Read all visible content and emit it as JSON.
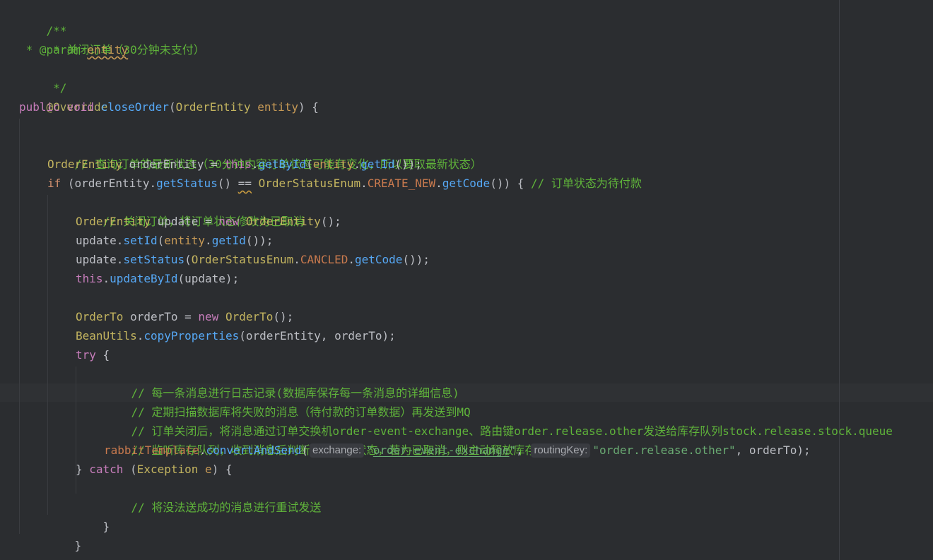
{
  "editor": {
    "doc_open": "/**",
    "doc_line1": " * 关闭订单（30分钟未支付）",
    "doc_star": " * ",
    "doc_param_tag": "@param",
    "doc_param_name": "entity",
    "doc_close": " */",
    "annotation": "@Override",
    "sig": {
      "public": "public",
      "void": "void",
      "name": "closeOrder",
      "type": "OrderEntity",
      "param": "entity",
      "tail": ") {"
    },
    "c_query": "// 查询订单的最新状态（30分钟内容订单状态可能有变化，所以要取最新状态）",
    "l_getbyid": {
      "type": "OrderEntity",
      "var": " orderEntity = ",
      "this": "this",
      "method": "getById",
      "arg": "entity",
      "getid": "getId",
      "tail": "());"
    },
    "l_if": {
      "kw": "if",
      "lhs": " (orderEntity.",
      "getstatus": "getStatus",
      "eq": "==",
      "enum": "OrderStatusEnum",
      "const": "CREATE_NEW",
      "getcode": "getCode",
      "tail": "()) { ",
      "comment": "// 订单状态为待付款"
    },
    "c_close": "// 关闭订单，将订单状态修改为已取消",
    "l_new_update": {
      "type": "OrderEntity",
      "var": " update = ",
      "new": "new",
      "ctor": "OrderEntity",
      "tail": "();"
    },
    "l_setid": {
      "obj": "update.",
      "method": "setId",
      "arg": "entity",
      "getid": "getId",
      "tail": "());"
    },
    "l_setstatus": {
      "obj": "update.",
      "method": "setStatus",
      "enum": "OrderStatusEnum",
      "const": "CANCLED",
      "getcode": "getCode",
      "tail": "());"
    },
    "l_update": {
      "this": "this",
      "method": "updateById",
      "tail": "(update);"
    },
    "l_orderto": {
      "type": "OrderTo",
      "var": " orderTo = ",
      "new": "new",
      "ctor": "OrderTo",
      "tail": "();"
    },
    "l_copy": {
      "cls": "BeanUtils",
      "method": "copyProperties",
      "tail": "(orderEntity, orderTo);"
    },
    "l_try": {
      "kw": "try",
      "tail": " {"
    },
    "c_log": "// 每一条消息进行日志记录(数据库保存每一条消息的详细信息)",
    "c_scan": "// 定期扫描数据库将失败的消息（待付款的订单数据）再发送到MQ",
    "c_route": "// 订单关闭后，将消息通过订单交换机order-event-exchange、路由键order.release.other发送给库存队列stock.release.stock.queue",
    "c_listen": "// 监听库存队列，收到消息后判断该订单的状态，若为已取消，则主动释放库存",
    "l_send": {
      "field": "rabbitTemplate",
      "method": "convertAndSend",
      "hint_exchange": "exchange:",
      "str_exchange": "order-event-exchange",
      "hint_routing": "routingKey:",
      "str_routing": "\"order.release.other\"",
      "tail": ", orderTo);"
    },
    "l_catch": {
      "close": "} ",
      "kw": "catch",
      "type": "Exception",
      "param": "e",
      "tail": ") {"
    },
    "c_retry": "// 将没法送成功的消息进行重试发送",
    "brace": "}"
  }
}
